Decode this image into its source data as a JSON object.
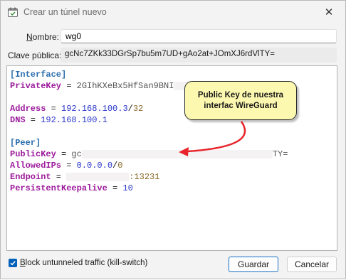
{
  "window": {
    "title": "Crear un túnel nuevo"
  },
  "form": {
    "name_label": "Nombre:",
    "name_value": "wg0",
    "pubkey_label": "Clave pública:",
    "pubkey_value": "gcNc7ZKk33DGrSp7bu5m7UD+gAo2at+JOmXJ6rdVlTY="
  },
  "config": {
    "interface_header": "[Interface]",
    "privatekey_key": "PrivateKey",
    "privatekey_value": "2GIhKXeBx5HfSan9BNI",
    "address_key": "Address",
    "address_ip": "192.168.100.3",
    "address_cidr": "32",
    "dns_key": "DNS",
    "dns_value": "192.168.100.1",
    "peer_header": "[Peer]",
    "publickey_key": "PublicKey",
    "publickey_start": "gc",
    "publickey_end": "TY=",
    "allowedips_key": "AllowedIPs",
    "allowedips_ip": "0.0.0.0",
    "allowedips_cidr": "0",
    "endpoint_key": "Endpoint",
    "endpoint_port": ":13231",
    "keepalive_key": "PersistentKeepalive",
    "keepalive_value": "10"
  },
  "annotation": {
    "callout_text": "Public Key de nuestra interfac WireGuard"
  },
  "footer": {
    "killswitch_label": "lock untunneled traffic (kill-switch)",
    "killswitch_accel": "B",
    "killswitch_checked": true,
    "save_label": "Guardar",
    "cancel_label": "Cancelar"
  },
  "colors": {
    "accent": "#005fb8",
    "callout_bg": "#fdf8b0",
    "arrow": "#e8232a"
  }
}
